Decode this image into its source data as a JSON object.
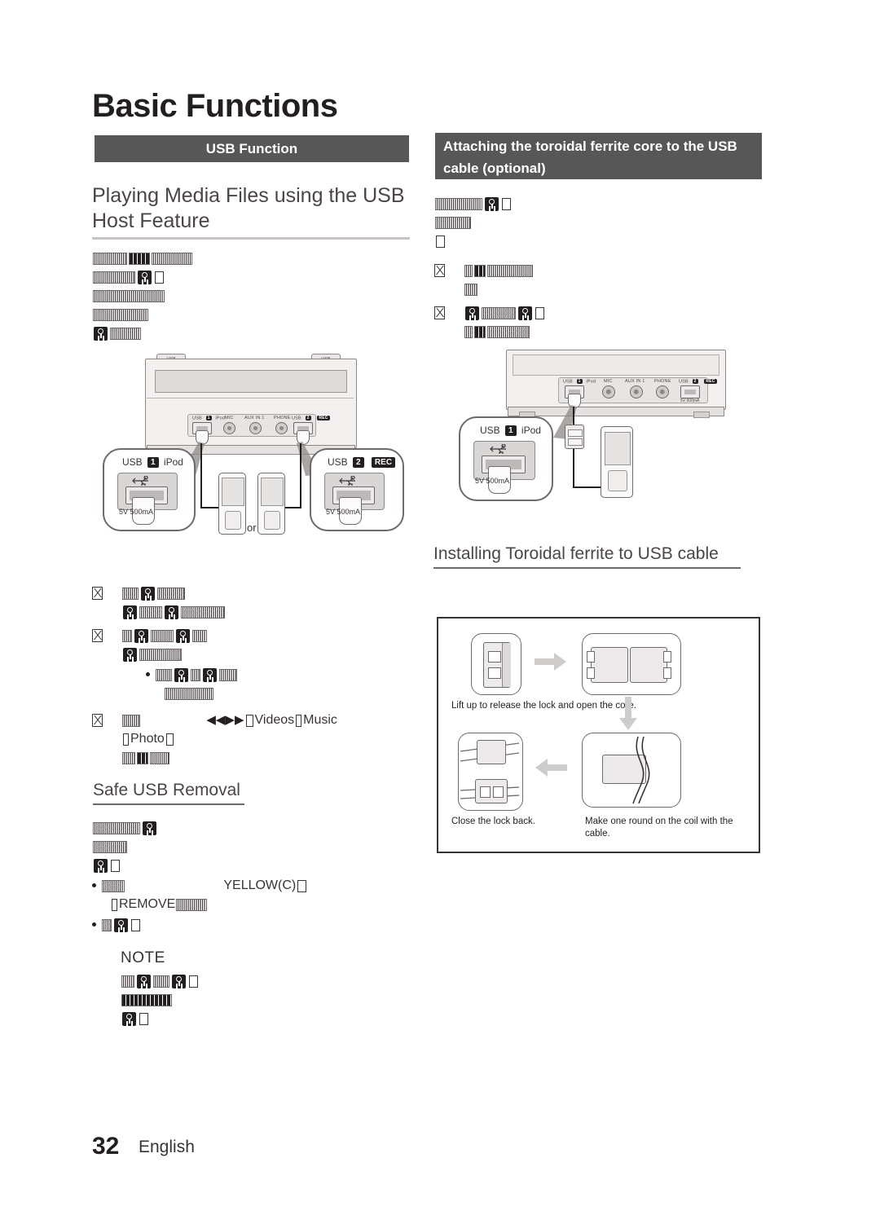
{
  "page": {
    "title": "Basic Functions",
    "number": "32",
    "language": "English"
  },
  "left_column": {
    "section_bar": "USB Function",
    "heading": "Playing Media Files using the USB Host Feature",
    "intro_lines": [
      {
        "glyphs": [
          "t4",
          "dk3",
          "t5"
        ]
      },
      {
        "glyphs": [
          "t5",
          "badge",
          "box"
        ]
      },
      {
        "glyphs": [
          "t9"
        ]
      },
      {
        "glyphs": [
          "t7"
        ]
      },
      {
        "glyphs": [
          "badge",
          "t4"
        ]
      }
    ],
    "steps": [
      {
        "marker": "xbox",
        "lines": [
          {
            "glyphs": [
              "t2",
              "badge",
              "t4"
            ]
          },
          {
            "glyphs": [
              "badge",
              "t3",
              "badge",
              "t6"
            ]
          }
        ]
      },
      {
        "marker": "xbox",
        "lines": [
          {
            "glyphs": [
              "t1",
              "badge",
              "t3",
              "badge",
              "t2"
            ]
          },
          {
            "glyphs": [
              "badge",
              "t6"
            ]
          }
        ],
        "bullets": [
          {
            "marker": "dot",
            "lines": [
              {
                "glyphs": [
                  "t2",
                  "badge",
                  "t1",
                  "badge",
                  "t3"
                ]
              },
              {
                "glyphs": [
                  "t7"
                ]
              }
            ]
          }
        ]
      },
      {
        "marker": "xbox",
        "lines": [
          {
            "glyphs": [
              "t3",
              "gap",
              "rew",
              "ffwd",
              "box"
            ],
            "text": "Videos",
            "text2": "Music"
          },
          {
            "glyphs": [
              "box"
            ],
            "text": "Photo",
            "glyphs2": [
              "box"
            ]
          },
          {
            "glyphs": [
              "t2",
              "dk2",
              "t3"
            ]
          }
        ]
      }
    ],
    "safe_removal": {
      "heading": "Safe USB Removal",
      "lines": [
        {
          "glyphs": [
            "t8",
            "badge"
          ]
        },
        {
          "glyphs": [
            "t5"
          ]
        },
        {
          "glyphs": [
            "badge",
            "box"
          ]
        }
      ],
      "bullets": [
        {
          "marker": "dot",
          "lines": [
            {
              "glyphs": [
                "t3",
                "gap2"
              ],
              "text": "YELLOW(C)",
              "glyphs2": [
                "box"
              ]
            },
            {
              "glyphs": [
                "box"
              ],
              "text": "REMOVE",
              "glyphs2": [
                "t5"
              ]
            }
          ]
        },
        {
          "marker": "dot",
          "lines": [
            {
              "glyphs": [
                "t1",
                "badge",
                "box"
              ]
            }
          ]
        }
      ]
    },
    "note": {
      "label": "NOTE",
      "lines": [
        {
          "glyphs": [
            "t2",
            "badge",
            "t2",
            "badge",
            "box"
          ]
        },
        {
          "glyphs": [
            "dk8"
          ]
        },
        {
          "glyphs": [
            "badge",
            "box"
          ]
        }
      ]
    }
  },
  "right_column": {
    "section_bar": "Attaching the toroidal ferrite core to the USB cable (optional)",
    "intro_lines": [
      {
        "glyphs": [
          "t7",
          "badge",
          "box"
        ]
      },
      {
        "glyphs": [
          "t6"
        ]
      },
      {
        "glyphs": [
          "box"
        ]
      }
    ],
    "steps": [
      {
        "marker": "xbox",
        "lines": [
          {
            "glyphs": [
              "t1",
              "dk2",
              "t7"
            ]
          },
          {
            "glyphs": [
              "t2"
            ]
          }
        ]
      },
      {
        "marker": "xbox",
        "lines": [
          {
            "glyphs": [
              "badge",
              "t5",
              "badge",
              "box"
            ]
          },
          {
            "glyphs": [
              "t1",
              "dk2",
              "t7"
            ]
          }
        ]
      }
    ],
    "installing_heading": "Installing Toroidal ferrite to USB cable"
  },
  "device_diagram": {
    "port_labels": [
      "USB",
      "iPod",
      "MIC",
      "AUX IN 1",
      "PHONE",
      "USB",
      "REC"
    ],
    "port_power": "5V 500mA",
    "usb_tab_label": "USB",
    "callouts": [
      {
        "prefix": "USB",
        "number": "1",
        "suffix": "iPod",
        "power": "5V 500mA"
      },
      {
        "prefix": "USB",
        "number": "2",
        "suffix": "REC",
        "power": "5V 500mA"
      }
    ],
    "or_label": "or"
  },
  "ferrite_panel": {
    "captions": [
      "Lift up to release the lock and open the core.",
      "Close the lock back.",
      "Make one round on the coil with the cable."
    ]
  },
  "colors": {
    "bar": "#575757",
    "text": "#231f20",
    "heading": "#4c4546",
    "rule": "#c9c4c3"
  }
}
